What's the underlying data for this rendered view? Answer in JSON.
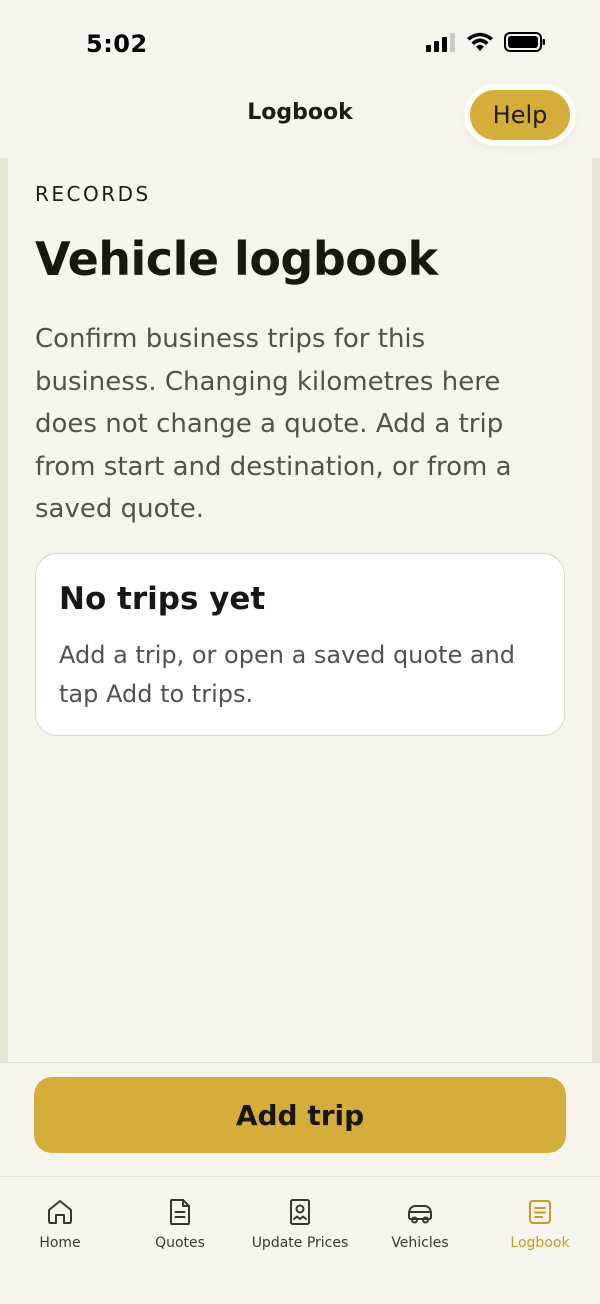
{
  "status_bar": {
    "time": "5:02"
  },
  "header": {
    "title": "Logbook",
    "help_label": "Help"
  },
  "content": {
    "eyebrow": "RECORDS",
    "title": "Vehicle logbook",
    "description": "Confirm business trips for this business. Changing kilometres here does not change a quote. Add a trip from start and destination, or from a saved quote.",
    "empty_state": {
      "title": "No trips yet",
      "body": "Add a trip, or open a saved quote and tap Add to trips."
    }
  },
  "action": {
    "add_trip_label": "Add trip"
  },
  "tabs": [
    {
      "label": "Home",
      "icon": "home-icon",
      "active": false
    },
    {
      "label": "Quotes",
      "icon": "document-icon",
      "active": false
    },
    {
      "label": "Update Prices",
      "icon": "receipt-icon",
      "active": false
    },
    {
      "label": "Vehicles",
      "icon": "car-icon",
      "active": false
    },
    {
      "label": "Logbook",
      "icon": "logbook-icon",
      "active": true
    }
  ],
  "colors": {
    "accent": "#d4ad3b",
    "active_tab": "#c49b26",
    "background": "#f7f4ed",
    "text": "#1f1c17"
  }
}
